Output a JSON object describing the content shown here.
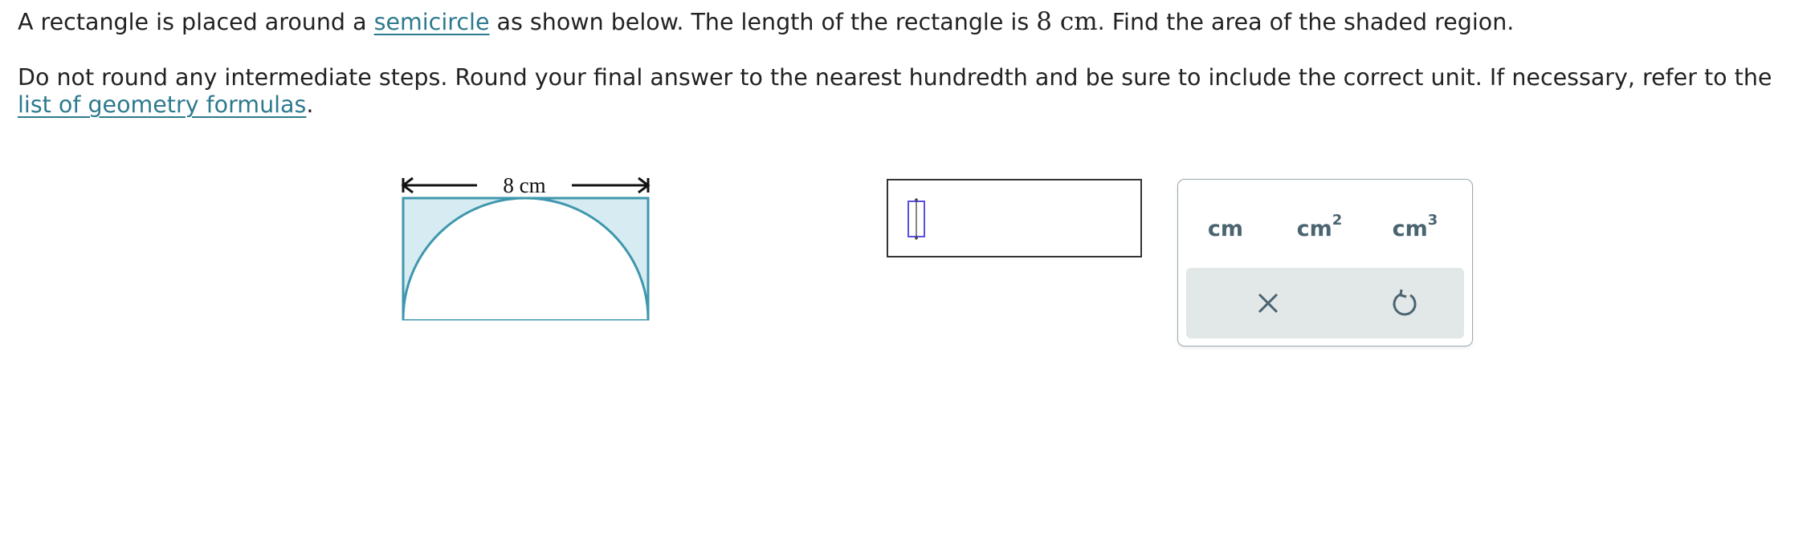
{
  "prompt": {
    "line1_before": "A rectangle is placed around a ",
    "line1_link": "semicircle",
    "line1_after_a": " as shown below. The length of the rectangle is ",
    "line1_math_value": "8",
    "line1_math_unit": "cm",
    "line1_after_b": ". Find the area of the shaded region.",
    "line2_before": "Do not round any intermediate steps. Round your final answer to the nearest hundredth and be sure to include the correct unit. If necessary, refer to the ",
    "line2_link": "list of geometry formulas",
    "line2_after": "."
  },
  "figure": {
    "dimension_label": "8 cm",
    "shade_color": "#d6ecf2",
    "stroke_color": "#3f97ad"
  },
  "answer": {
    "value": ""
  },
  "palette": {
    "units": [
      {
        "base": "cm",
        "exponent": ""
      },
      {
        "base": "cm",
        "exponent": "2"
      },
      {
        "base": "cm",
        "exponent": "3"
      }
    ],
    "actions": [
      "clear-icon",
      "undo-icon"
    ]
  }
}
